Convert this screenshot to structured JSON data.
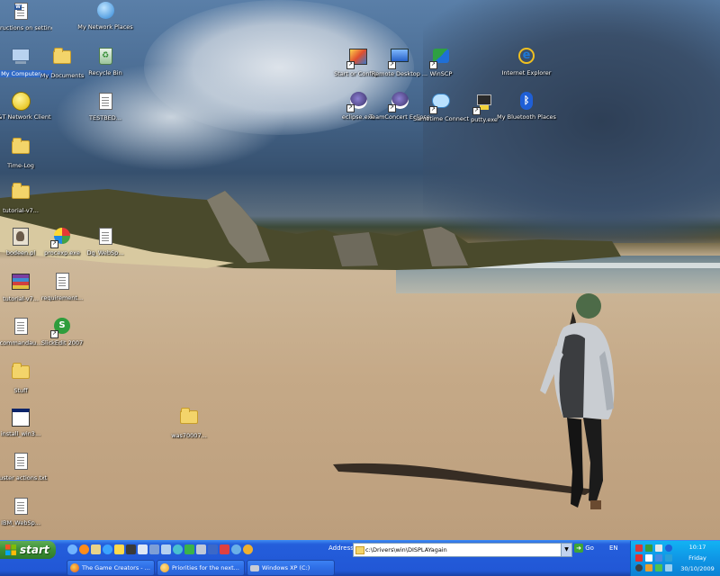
{
  "desktop_icons": [
    {
      "label": "Instructions on setting ...",
      "icon": "word-document-icon"
    },
    {
      "label": "My Network Places",
      "icon": "network-places-icon"
    },
    {
      "label": "My Computer",
      "icon": "my-computer-icon"
    },
    {
      "label": "My Documents",
      "icon": "my-documents-icon"
    },
    {
      "label": "Recycle Bin",
      "icon": "recycle-bin-icon"
    },
    {
      "label": "AT&T Network Client",
      "icon": "att-globe-icon"
    },
    {
      "label": "TESTBED...",
      "icon": "text-file-icon"
    },
    {
      "label": "Time-Log",
      "icon": "folder-icon"
    },
    {
      "label": "tutorial-v7...",
      "icon": "folder-icon"
    },
    {
      "label": "bodeen.pl",
      "icon": "perl-file-icon"
    },
    {
      "label": "procexp.exe",
      "icon": "process-explorer-icon"
    },
    {
      "label": "Dg_WebSp...",
      "icon": "text-file-icon"
    },
    {
      "label": "tutorial-v7...",
      "icon": "archive-icon"
    },
    {
      "label": "requirement...",
      "icon": "text-file-icon"
    },
    {
      "label": "commandau...",
      "icon": "text-file-icon"
    },
    {
      "label": "SlickEdit 2007",
      "icon": "slickedit-icon"
    },
    {
      "label": "Stuff",
      "icon": "folder-icon"
    },
    {
      "label": "install_win3...",
      "icon": "window-app-icon"
    },
    {
      "label": "was70007...",
      "icon": "folder-icon"
    },
    {
      "label": "cluster actions.txt",
      "icon": "text-file-icon"
    },
    {
      "label": "IBM_WebSp...",
      "icon": "text-file-icon"
    },
    {
      "label": "Start or Config...",
      "icon": "config-shortcut-icon"
    },
    {
      "label": "Remote Desktop ...",
      "icon": "remote-desktop-icon"
    },
    {
      "label": "WinSCP",
      "icon": "winscp-icon"
    },
    {
      "label": "Internet Explorer",
      "icon": "internet-explorer-icon"
    },
    {
      "label": "eclipse.exe",
      "icon": "eclipse-icon"
    },
    {
      "label": "TeamConcert Eclipse",
      "icon": "eclipse-icon"
    },
    {
      "label": "Sametime Connect",
      "icon": "sametime-icon"
    },
    {
      "label": "putty.exe",
      "icon": "putty-icon"
    },
    {
      "label": "My Bluetooth Places",
      "icon": "bluetooth-icon"
    }
  ],
  "taskbar": {
    "start_label": "start",
    "address_label": "Address",
    "address_value": "c:\\Drivers\\win\\DISPLAYagain",
    "go_label": "Go",
    "language": "EN",
    "tasks": [
      {
        "label": "The Game Creators - ...",
        "icon": "firefox-icon"
      },
      {
        "label": "Priorities for the next...",
        "icon": "sametime-chat-icon"
      },
      {
        "label": "Windows XP (C:)",
        "icon": "drive-icon"
      }
    ],
    "clock": {
      "time": "10:17",
      "day": "Friday",
      "date": "30/10/2009"
    }
  },
  "colors": {
    "taskbar": "#245edb",
    "start": "#3c8f35",
    "tray": "#0f96e6",
    "selection": "#316ac5"
  }
}
